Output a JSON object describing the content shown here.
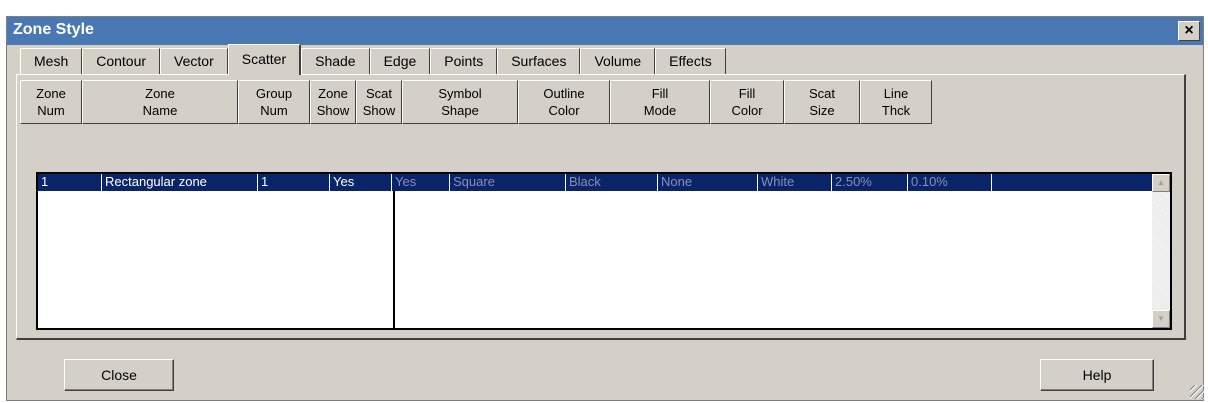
{
  "window": {
    "title": "Zone Style",
    "close_glyph": "×"
  },
  "tabs": [
    {
      "label": "Mesh",
      "active": false
    },
    {
      "label": "Contour",
      "active": false
    },
    {
      "label": "Vector",
      "active": false
    },
    {
      "label": "Scatter",
      "active": true
    },
    {
      "label": "Shade",
      "active": false
    },
    {
      "label": "Edge",
      "active": false
    },
    {
      "label": "Points",
      "active": false
    },
    {
      "label": "Surfaces",
      "active": false
    },
    {
      "label": "Volume",
      "active": false
    },
    {
      "label": "Effects",
      "active": false
    }
  ],
  "columns": [
    "Zone\nNum",
    "Zone\nName",
    "Group\nNum",
    "Zone\nShow",
    "Scat\nShow",
    "Symbol\nShape",
    "Outline\nColor",
    "Fill\nMode",
    "Fill\nColor",
    "Scat\nSize",
    "Line\nThck"
  ],
  "row": [
    "1",
    "Rectangular zone",
    "1",
    "Yes",
    "Yes",
    "Square",
    "Black",
    "None",
    "White",
    "2.50%",
    "0.10%"
  ],
  "scrollbar": {
    "up_glyph": "▲",
    "down_glyph": "▼"
  },
  "buttons": {
    "close": "Close",
    "help": "Help"
  },
  "colors": {
    "titlebar": "#4a78b4",
    "dialog_bg": "#d4d0c8",
    "selection": "#0a246a",
    "dimmed_text": "#8a8fb4"
  }
}
